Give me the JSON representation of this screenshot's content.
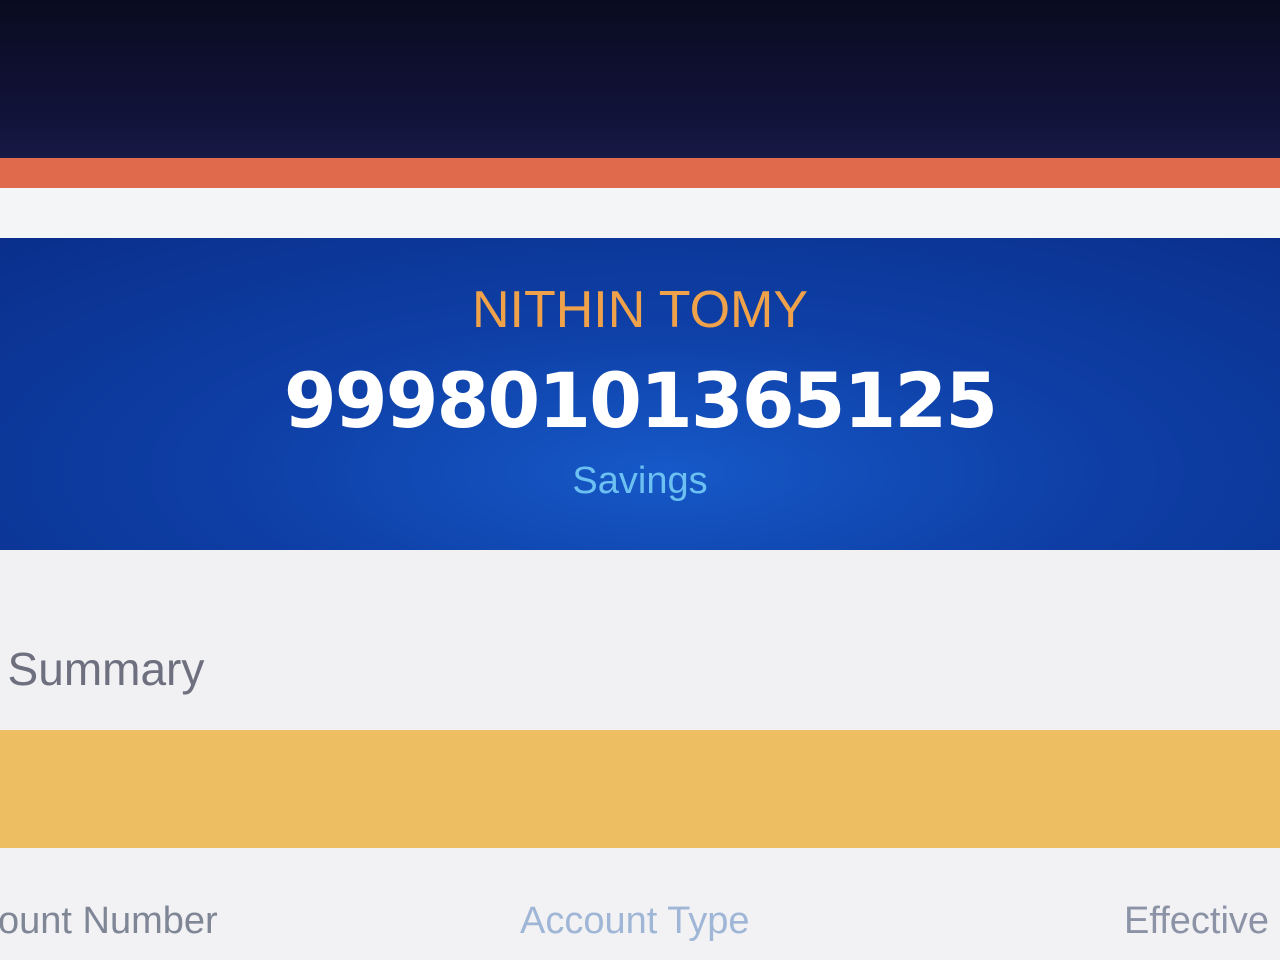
{
  "account": {
    "holder_name": "NITHIN TOMY",
    "number": "99980101365125",
    "type": "Savings"
  },
  "summary": {
    "title": "t Summary"
  },
  "table": {
    "headers": [
      "ccount Number",
      "Account Type",
      "Effective"
    ]
  },
  "colors": {
    "top_accent": "#e06a4c",
    "banner_blue": "#0e3fa6",
    "name_orange": "#f0a24a",
    "type_cyan": "#6cc0f2",
    "table_bar_yellow": "#eebf62"
  }
}
